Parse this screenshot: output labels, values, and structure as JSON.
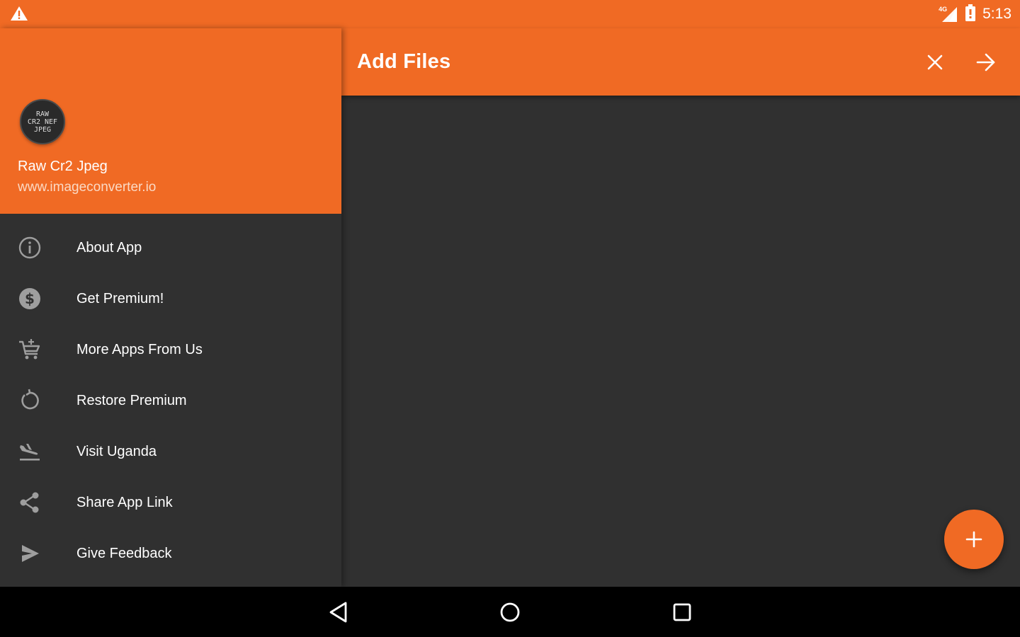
{
  "status_bar": {
    "time": "5:13",
    "network": "4G",
    "icons": [
      "warning-icon",
      "signal-icon",
      "battery-icon"
    ]
  },
  "app_bar": {
    "title": "Add Files",
    "actions": [
      "close-icon",
      "arrow-forward-icon"
    ]
  },
  "drawer": {
    "avatar_text": [
      "RAW",
      "CR2 NEF",
      "JPEG"
    ],
    "app_name": "Raw Cr2 Jpeg",
    "app_url": "www.imageconverter.io",
    "items": [
      {
        "label": "About App",
        "icon": "info-icon"
      },
      {
        "label": "Get Premium!",
        "icon": "dollar-icon"
      },
      {
        "label": "More Apps From Us",
        "icon": "cart-icon"
      },
      {
        "label": "Restore Premium",
        "icon": "restore-icon"
      },
      {
        "label": "Visit Uganda",
        "icon": "plane-icon"
      },
      {
        "label": "Share App Link",
        "icon": "share-icon"
      },
      {
        "label": "Give Feedback",
        "icon": "send-icon"
      }
    ]
  },
  "fab": {
    "icon": "add-icon"
  },
  "nav_bar": {
    "buttons": [
      "back-icon",
      "home-icon",
      "recents-icon"
    ]
  },
  "colors": {
    "accent": "#F06A24",
    "background": "#303030",
    "nav_bar": "#000000",
    "icon_gray": "#9e9e9e"
  }
}
